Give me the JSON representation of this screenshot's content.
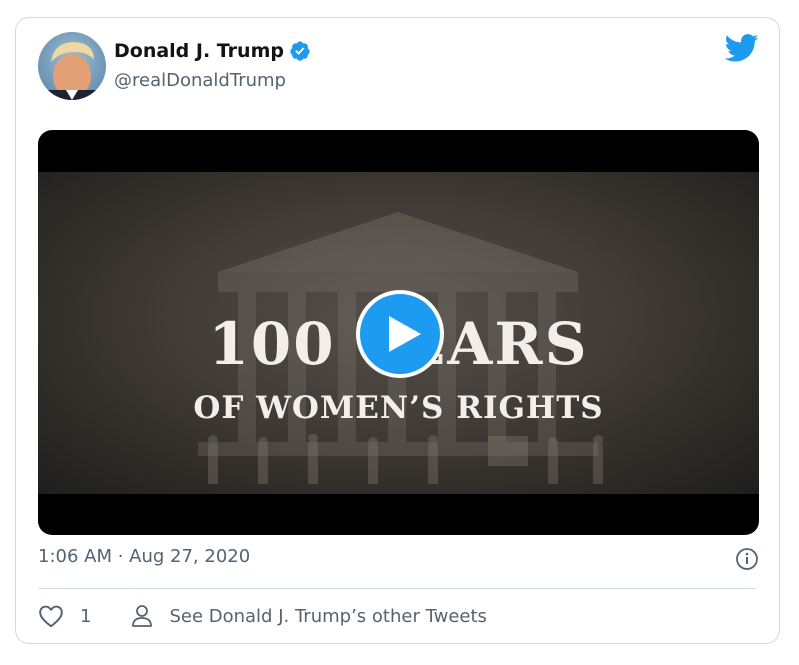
{
  "tweet": {
    "author_name": "Donald J. Trump",
    "author_handle": "@realDonaldTrump",
    "verified": true,
    "timestamp": "1:06 AM · Aug 27, 2020",
    "like_count": "1",
    "other_tweets_label": "See Donald J. Trump’s other Tweets"
  },
  "media": {
    "type": "video",
    "title_line1": "100 YEARS",
    "title_line2": "OF WOMEN’S RIGHTS"
  },
  "icons": {
    "verified": "verified-badge-icon",
    "brand": "twitter-bird-icon",
    "play": "play-icon",
    "info": "info-icon",
    "like": "heart-icon",
    "profile": "person-icon"
  },
  "colors": {
    "accent": "#1d9bf0",
    "text_primary": "#0f1419",
    "text_secondary": "#536471",
    "border": "#cfd9de"
  }
}
